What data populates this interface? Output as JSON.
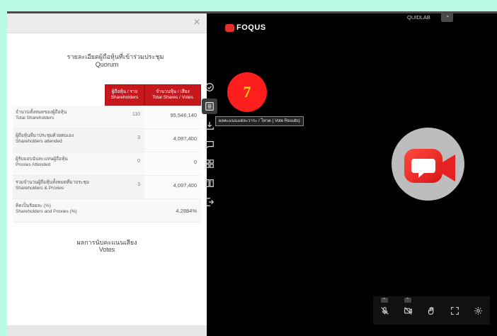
{
  "panel": {
    "close_label": "×",
    "title_th": "รายละเอียดผู้ถือหุ้นที่เข้าร่วมประชุม",
    "title_en": "Quorum",
    "col1_th": "ผู้ถือหุ้น / ราย",
    "col1_en": "Shareholders",
    "col2_th": "จำนวนหุ้น / เสียง",
    "col2_en": "Total Shares / Votes",
    "rows": [
      {
        "th": "จำนวนทั้งหมดของผู้ถือหุ้น",
        "en": "Total Shareholders",
        "shareholders": "110",
        "shares": "95,546,140"
      },
      {
        "th": "ผู้ถือหุ้นที่มาประชุมด้วยตนเอง",
        "en": "Shareholders attended",
        "shareholders": "3",
        "shares": "4,097,400"
      },
      {
        "th": "ผู้รับมอบฉันทะแทนผู้ถือหุ้น",
        "en": "Proxies Attended",
        "shareholders": "0",
        "shares": "0"
      },
      {
        "th": "รวมจำนวนผู้ถือหุ้นทั้งหมดที่มาประชุม",
        "en": "Shareholders & Proxies",
        "shareholders": "3",
        "shares": "4,097,400"
      }
    ],
    "percent_row": {
      "th": "คิดเป็นร้อยละ (%)",
      "en": "Shareholders and Proxies (%)",
      "value": "4.2884%"
    },
    "votes_th": "ผลการนับคะแนนเสียง",
    "votes_en": "Votes"
  },
  "header": {
    "logo_text": "FOQUS",
    "user": "QUIDLAB",
    "user_button_icon": "account-icon"
  },
  "sidebar": {
    "tooltip": "ผลคะแนนแต่ละวาระ / โหวต ( Vote Results)",
    "items": [
      "check-circle-icon",
      "list-icon",
      "download-icon",
      "chat-icon",
      "grid-icon",
      "book-icon",
      "logout-icon"
    ]
  },
  "badge": {
    "number": "7",
    "color": "#ff1e1e"
  },
  "controls": [
    "mic-off-icon",
    "camera-off-icon",
    "hand-icon",
    "fullscreen-icon",
    "settings-icon"
  ],
  "colors": {
    "accent": "#c8161d",
    "background": "#b9fbe6"
  }
}
